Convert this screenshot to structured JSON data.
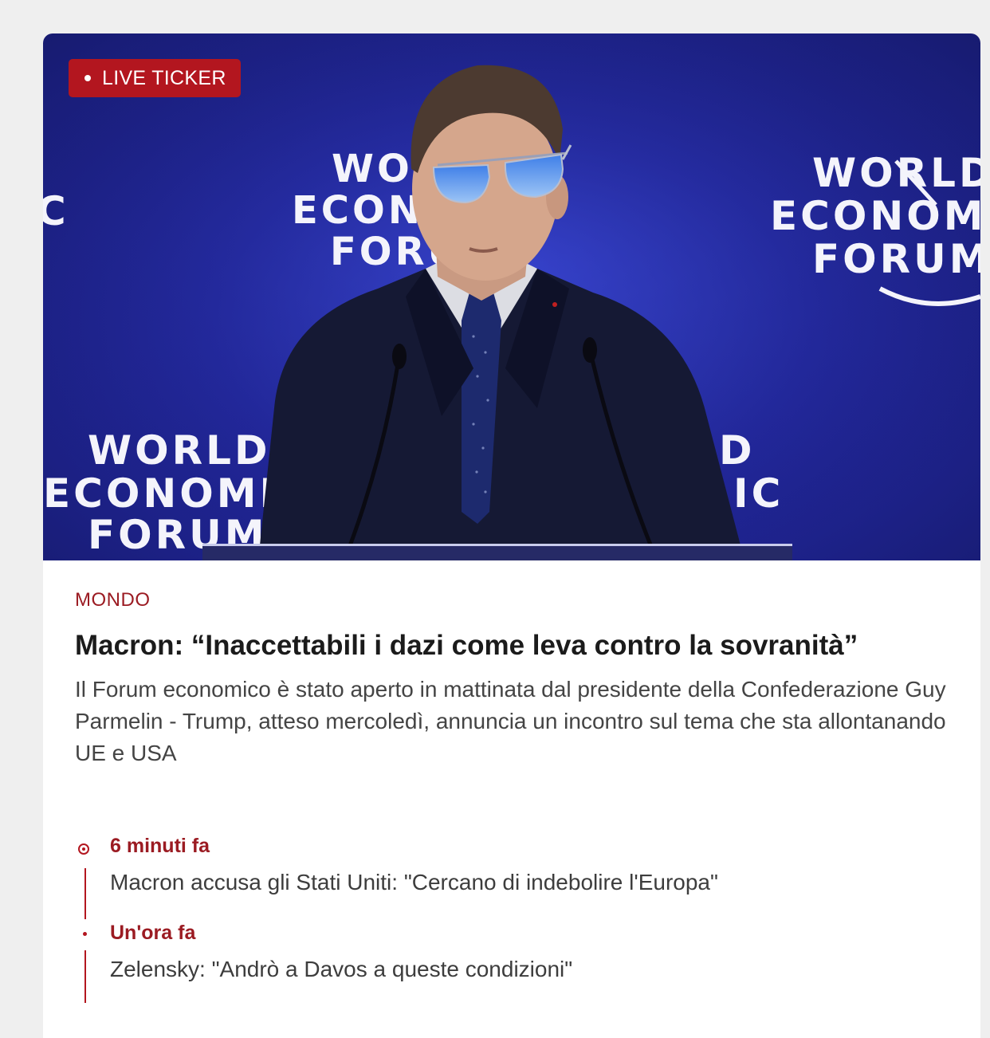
{
  "hero": {
    "badge": "LIVE TICKER",
    "photo_text": {
      "left_c": "C",
      "top_line1": "WORLD",
      "top_line2": "ECONOMIC",
      "top_line3": "FORUM",
      "right_line1": "WORLD",
      "right_line2": "ECONOMIC",
      "right_line3": "FORUM",
      "bottom_line1": "WORLD",
      "bottom_line2": "ECONOMIC",
      "bottom_line3": "FORUM",
      "bottom_right": "D",
      "bottom_right2": "IC"
    }
  },
  "article": {
    "category": "MONDO",
    "headline": "Macron: “Inaccettabili i dazi come leva contro la sovranità”",
    "summary": "Il Forum economico è stato aperto in mattinata dal presidente della Confederazione Guy Parmelin - Trump, atteso mercoledì, annuncia un incontro sul tema che sta allontanando UE e USA"
  },
  "ticker": [
    {
      "time": "6 minuti fa",
      "text": "Macron accusa gli Stati Uniti: \"Cercano di indebolire l'Europa\""
    },
    {
      "time": "Un'ora fa",
      "text": "Zelensky: \"Andrò a Davos a queste condizioni\""
    }
  ],
  "colors": {
    "accent": "#b3161f",
    "category": "#9b1b22",
    "hero_blue": "#22279e"
  }
}
